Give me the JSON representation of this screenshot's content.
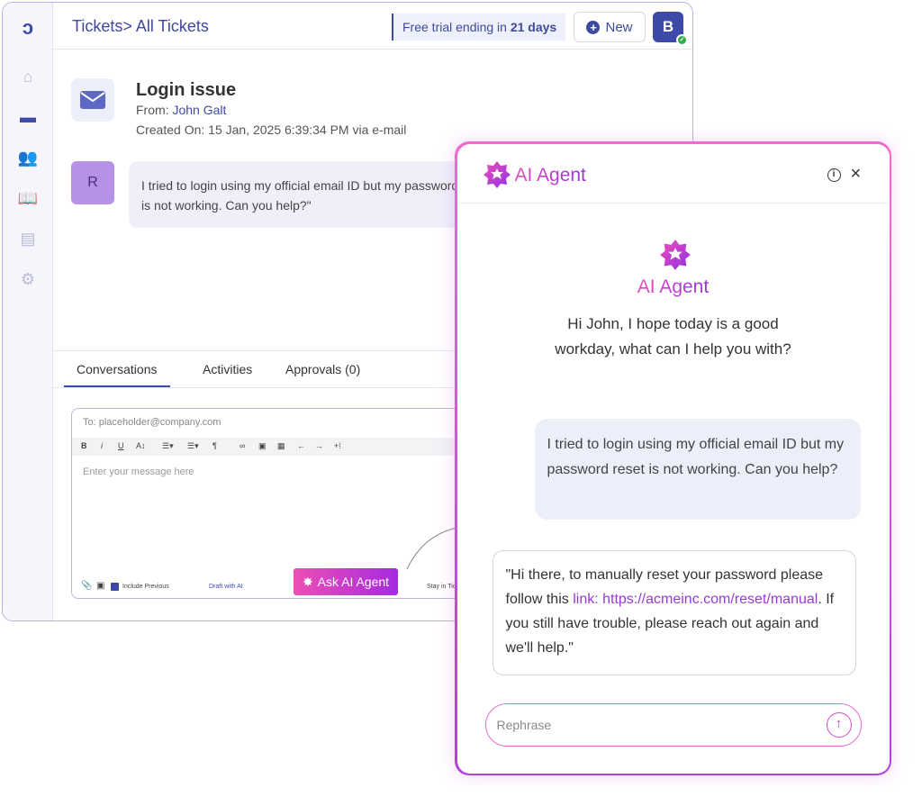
{
  "header": {
    "breadcrumb": "Tickets> All Tickets",
    "trial_prefix": "Free trial ending in ",
    "trial_days": "21 days",
    "new_label": "New",
    "avatar_initial": "B"
  },
  "sidebar": {
    "items": [
      "logo",
      "home",
      "tickets",
      "contacts",
      "knowledge-base",
      "reports",
      "settings"
    ]
  },
  "ticket": {
    "title": "Login issue",
    "from_label": "From: ",
    "from_name": "John Galt",
    "created": "Created On: 15 Jan, 2025 6:39:34 PM via e-mail",
    "requester_initial": "R",
    "message": "I tried to login using my official email ID but my password reset is not working. Can you help?\""
  },
  "tabs": [
    {
      "label": "Conversations",
      "active": true
    },
    {
      "label": "Activities"
    },
    {
      "label": "Approvals (0)"
    }
  ],
  "editor": {
    "to": "To: placeholder@company.com",
    "placeholder": "Enter your message here",
    "include_previous": "Include Previous",
    "draft_ai": "Draft with AI",
    "ask_ai": "Ask AI Agent",
    "stay": "Stay in Ticke"
  },
  "ai_panel": {
    "title": "AI Agent",
    "center_title": "AI Agent",
    "greeting": "Hi John, I hope today is a good workday, what can I help you with?",
    "user_message": "I tried to login using my official email ID but my password reset is not working. Can you help?",
    "reply_before": "\"Hi there, to manually reset your password please follow this ",
    "reply_link": "link: https://acmeinc.com/reset/manual",
    "reply_after": ". If you still have trouble, please reach out again and we'll help.\"",
    "input_placeholder": "Rephrase"
  },
  "colors": {
    "primary": "#3e4aa8",
    "ai_pink": "#e64cc0",
    "ai_purple": "#9a32de"
  }
}
